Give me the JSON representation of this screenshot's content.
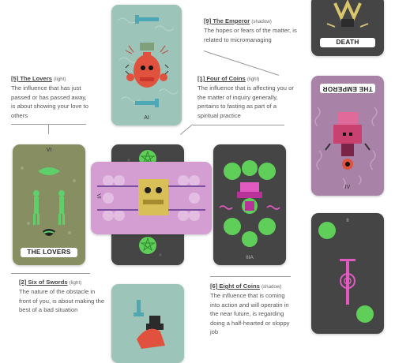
{
  "notes": [
    {
      "id": "emperor",
      "number": "[9]",
      "card": "The Emperor",
      "kind": "(shadow)",
      "text": "The hopes or fears of the matter, is related to micromanaging"
    },
    {
      "id": "lovers",
      "number": "[5]",
      "card": "The Lovers",
      "kind": "(light)",
      "text": "The influence that has just passed or has passed away, is about showing your love to others"
    },
    {
      "id": "four-coins",
      "number": "[1]",
      "card": "Four of Coins",
      "kind": "(light)",
      "text": "The influence that is affecting you or the matter of inquiry generally, pertains to fasting as part of a spiritual practice"
    },
    {
      "id": "six-swords",
      "number": "[2]",
      "card": "Six of Swords",
      "kind": "(light)",
      "text": "The nature of the obstacle in front of you, is about making the best of a bad situation"
    },
    {
      "id": "eight-coins",
      "number": "[6]",
      "card": "Eight of Coins",
      "kind": "(shadow)",
      "text": "The influence that is coming into action and will operatin in the near future, is regarding doing a half-hearted or sloppy job"
    }
  ],
  "cards": {
    "death_label": "DEATH",
    "emperor_label": "THE EMPEROR",
    "emperor_numeral": "IV",
    "lovers_label": "THE LOVERS",
    "lovers_numeral": "VI",
    "top_numeral": "AI",
    "six_numeral": "VI",
    "eight_numeral": "IIIA",
    "right_numeral": "II"
  },
  "colors": {
    "teal": "#9cc4b8",
    "olive": "#868e62",
    "dark": "#454545",
    "pink": "#d59ed2",
    "purple": "#a982a8",
    "coin": "#5fcf5a"
  }
}
